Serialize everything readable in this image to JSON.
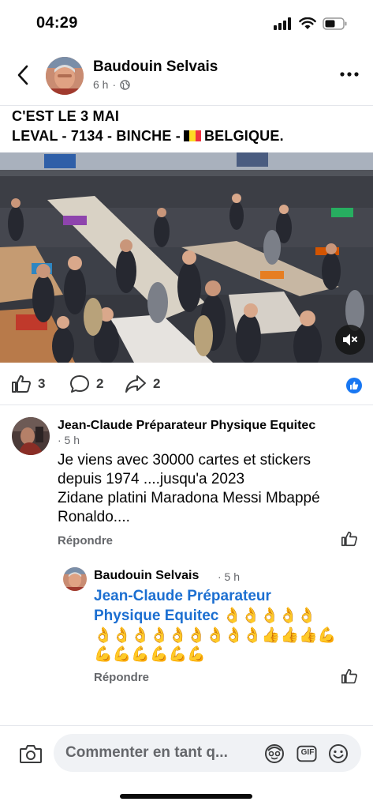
{
  "status_bar": {
    "time": "04:29"
  },
  "post": {
    "author": "Baudouin Selvais",
    "time_ago": "6 h",
    "separator": "·",
    "text_line1": "C'EST LE 3 MAI",
    "text_line2_a": "LEVAL - 7134 - BINCHE  -",
    "text_line2_b": "BELGIQUE.",
    "flag_colors": [
      "#000000",
      "#fdda24",
      "#ef3340"
    ],
    "likes": "3",
    "comments": "2",
    "shares": "2"
  },
  "comments": [
    {
      "author": "Jean-Claude Préparateur Physique Equitec",
      "time_ago": "· 5 h",
      "lines": [
        "Je viens avec 30000 cartes et stickers",
        "depuis 1974 ....jusqu'a 2023",
        "Zidane platini Maradona Messi Mbappé",
        "Ronaldo...."
      ],
      "reply_label": "Répondre"
    },
    {
      "author": "Baudouin Selvais",
      "time_ago": "· 5 h",
      "mention_line1": "Jean-Claude Préparateur",
      "mention_line2": "Physique Equitec",
      "emoji_line1": "👌👌👌👌👌",
      "emoji_line2": "👌👌👌👌👌👌👌👌👌👍👍👍💪",
      "emoji_line3": "💪💪💪💪💪💪",
      "reply_label": "Répondre"
    }
  ],
  "composer": {
    "placeholder": "Commenter en tant q...",
    "gif_label": "GIF"
  },
  "icons": {
    "back": "chevron-left-icon",
    "more": "more-horizontal-icon",
    "public": "globe-icon",
    "mute": "mute-icon",
    "like": "thumbs-up-icon",
    "comment": "comment-bubble-icon",
    "share": "share-arrow-icon",
    "camera": "camera-icon",
    "avatar_sticker": "avatar-sticker-icon",
    "emoji": "emoji-icon"
  },
  "colors": {
    "link": "#1c6fd1",
    "like_badge": "#1877f2",
    "secondary_text": "#65676b"
  }
}
